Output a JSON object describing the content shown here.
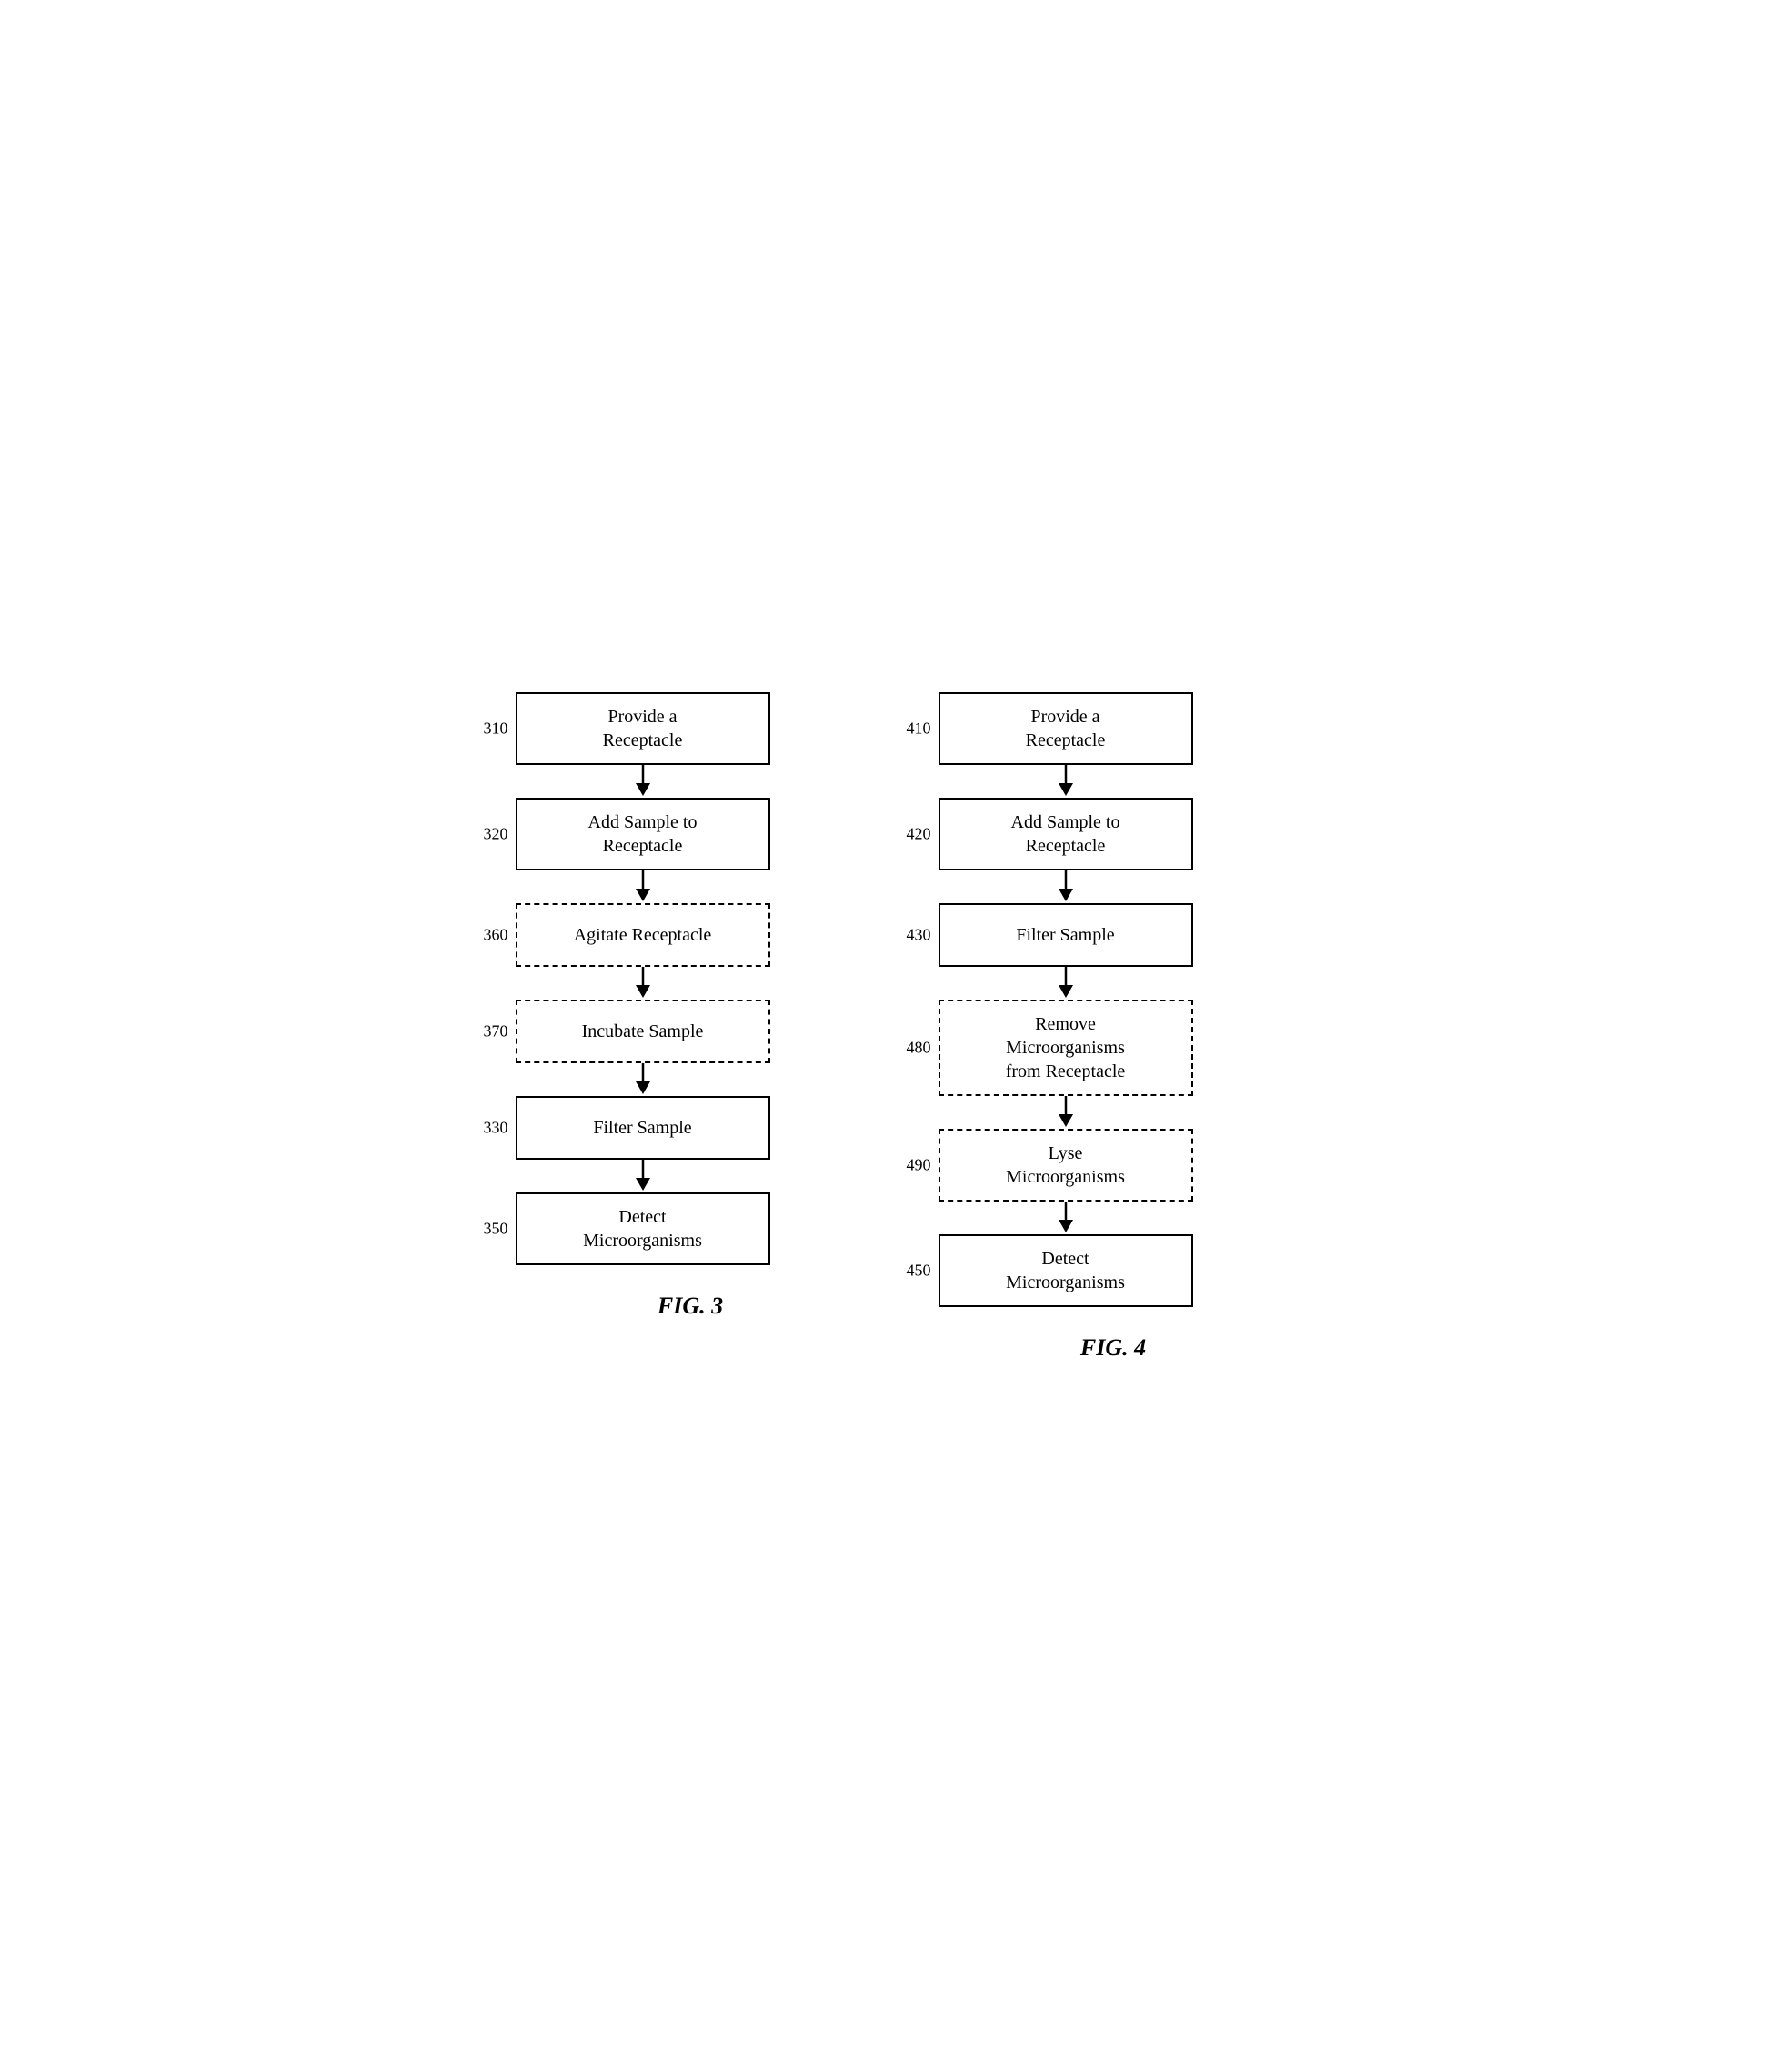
{
  "fig3": {
    "label": "FIG. 3",
    "steps": [
      {
        "id": "310",
        "text": "Provide a\nReceptacle",
        "dashed": false
      },
      {
        "id": "320",
        "text": "Add Sample to\nReceptacle",
        "dashed": false
      },
      {
        "id": "360",
        "text": "Agitate Receptacle",
        "dashed": true
      },
      {
        "id": "370",
        "text": "Incubate Sample",
        "dashed": true
      },
      {
        "id": "330",
        "text": "Filter Sample",
        "dashed": false
      },
      {
        "id": "350",
        "text": "Detect\nMicroorganisms",
        "dashed": false
      }
    ]
  },
  "fig4": {
    "label": "FIG. 4",
    "steps": [
      {
        "id": "410",
        "text": "Provide a\nReceptacle",
        "dashed": false
      },
      {
        "id": "420",
        "text": "Add Sample to\nReceptacle",
        "dashed": false
      },
      {
        "id": "430",
        "text": "Filter Sample",
        "dashed": false
      },
      {
        "id": "480",
        "text": "Remove\nMicroorganisms\nfrom Receptacle",
        "dashed": true
      },
      {
        "id": "490",
        "text": "Lyse\nMicroorganisms",
        "dashed": true
      },
      {
        "id": "450",
        "text": "Detect\nMicroorganisms",
        "dashed": false
      }
    ]
  }
}
